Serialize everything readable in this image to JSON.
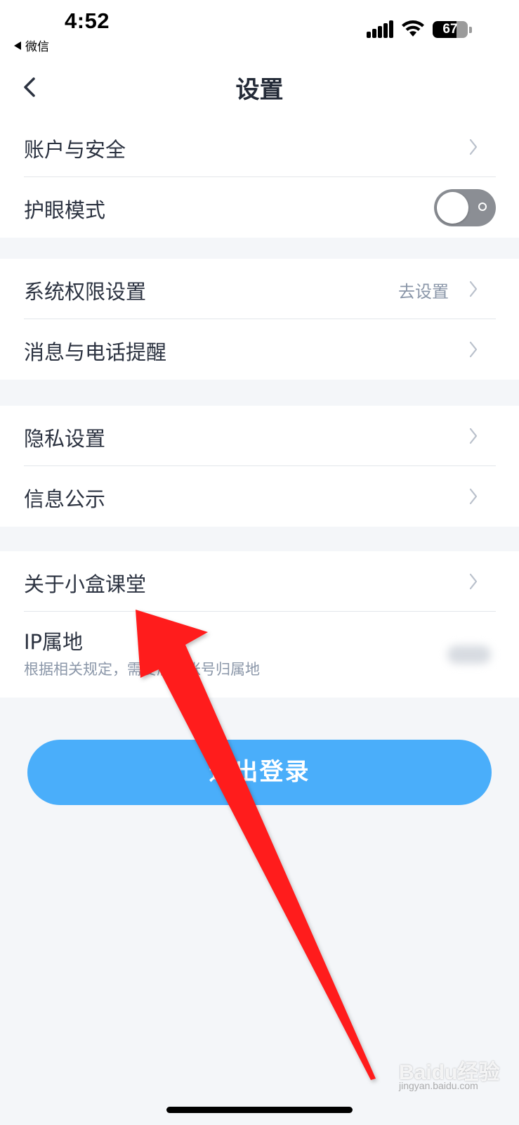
{
  "status_bar": {
    "time": "4:52",
    "back_app": "微信",
    "battery": "67",
    "battery_level": 0.67
  },
  "nav": {
    "title": "设置"
  },
  "groups": [
    {
      "rows": [
        {
          "label": "账户与安全",
          "type": "link"
        },
        {
          "label": "护眼模式",
          "type": "toggle",
          "on": false
        }
      ]
    },
    {
      "rows": [
        {
          "label": "系统权限设置",
          "value": "去设置",
          "type": "link"
        },
        {
          "label": "消息与电话提醒",
          "type": "link"
        }
      ]
    },
    {
      "rows": [
        {
          "label": "隐私设置",
          "type": "link"
        },
        {
          "label": "信息公示",
          "type": "link"
        }
      ]
    },
    {
      "rows": [
        {
          "label": "关于小盒课堂",
          "type": "link"
        },
        {
          "label": "IP属地",
          "subtitle": "根据相关规定，需要展示账号归属地",
          "type": "info"
        }
      ]
    }
  ],
  "logout": {
    "label": "退出登录"
  },
  "watermark": {
    "text": "Baidu经验",
    "url": "jingyan.baidu.com"
  },
  "colors": {
    "accent": "#4aaefa",
    "background": "#f4f6f9",
    "annotation_arrow": "#ff1a1a"
  }
}
